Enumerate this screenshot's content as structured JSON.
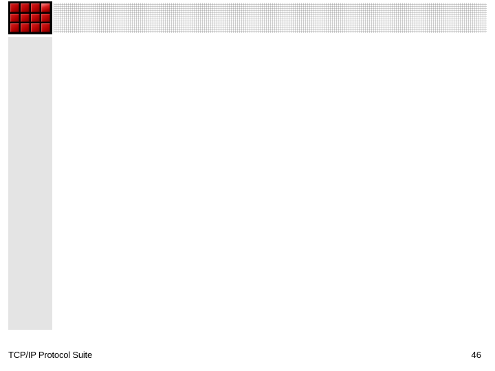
{
  "footer": {
    "title": "TCP/IP Protocol Suite",
    "page_number": "46"
  }
}
